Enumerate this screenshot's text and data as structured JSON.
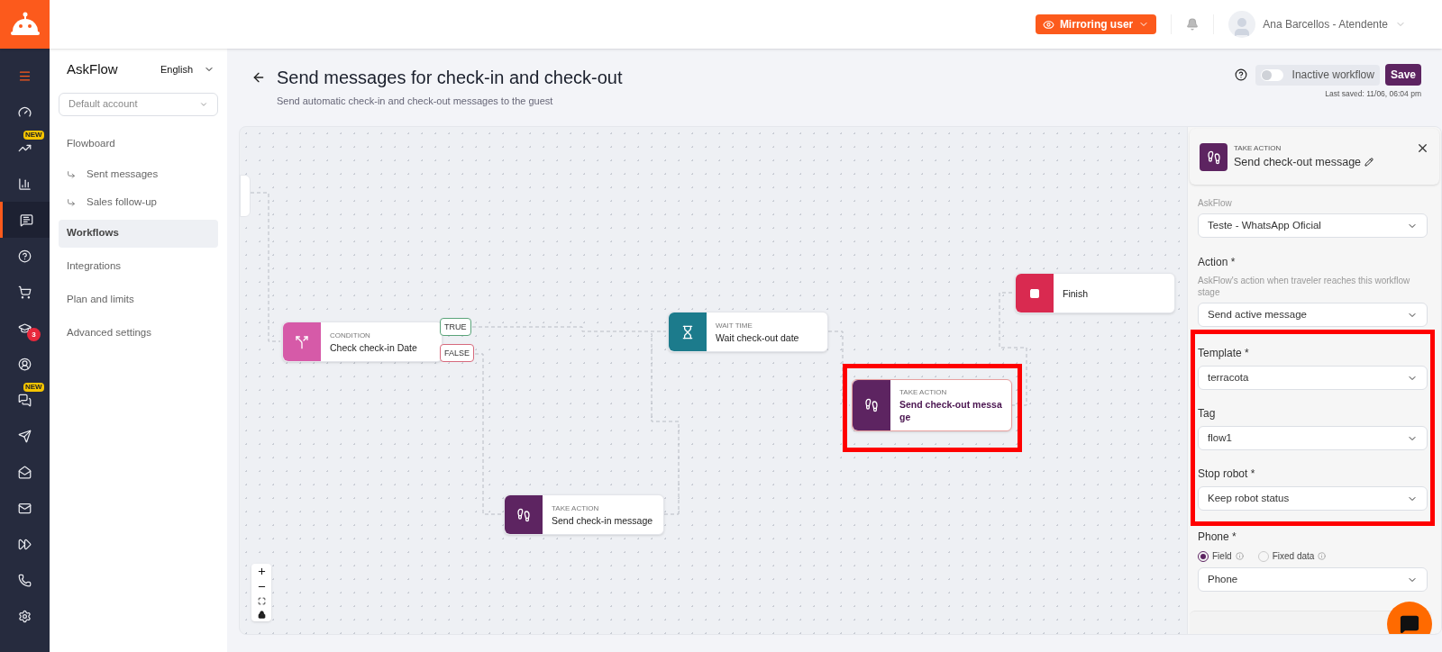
{
  "topbar": {
    "mirroring_button": "Mirroring user",
    "user_name": "Ana Barcellos - Atendente"
  },
  "rail": [
    {
      "selected": false
    },
    {
      "selected": false
    },
    {
      "selected": false,
      "badge": "NEW"
    },
    {
      "selected": false
    },
    {
      "selected": true
    },
    {
      "selected": false
    },
    {
      "selected": false
    },
    {
      "selected": false,
      "badge": "3"
    },
    {
      "selected": false
    },
    {
      "selected": false,
      "badge": "NEW"
    },
    {
      "selected": false
    },
    {
      "selected": false
    },
    {
      "selected": false
    },
    {
      "selected": false
    },
    {
      "selected": false
    },
    {
      "selected": false
    }
  ],
  "sidebar": {
    "brand": "AskFlow",
    "language": "English",
    "account": "Default account",
    "items": [
      {
        "label": "Flowboard",
        "kind": "main",
        "selected": false
      },
      {
        "label": "Sent messages",
        "kind": "sub",
        "selected": false
      },
      {
        "label": "Sales follow-up",
        "kind": "sub",
        "selected": false
      },
      {
        "label": "Workflows",
        "kind": "main",
        "selected": true
      },
      {
        "label": "Integrations",
        "kind": "main",
        "selected": false
      },
      {
        "label": "Plan and limits",
        "kind": "main",
        "selected": false
      },
      {
        "label": "Advanced settings",
        "kind": "main",
        "selected": false
      }
    ]
  },
  "header": {
    "title": "Send messages for check-in and check-out",
    "subtitle": "Send automatic check-in and check-out messages to the guest",
    "toggle": {
      "label": "Inactive workflow",
      "on": false
    },
    "save": "Save",
    "last_saved": "Last saved: 11/06, 06:04 pm"
  },
  "canvas": {
    "nodes": [
      {
        "kind": "condition",
        "caption": "CONDITION",
        "title": "Check check-in Date",
        "highlighted": false,
        "outputs": [
          "TRUE",
          "FALSE"
        ]
      },
      {
        "kind": "wait",
        "caption": "WAIT TIME",
        "title": "Wait check-out date",
        "highlighted": false
      },
      {
        "kind": "action",
        "caption": "TAKE ACTION",
        "title": "Send check-out message",
        "highlighted": true
      },
      {
        "kind": "action",
        "caption": "TAKE ACTION",
        "title": "Send check-in message",
        "highlighted": false
      },
      {
        "kind": "finish",
        "title": "Finish",
        "highlighted": false
      }
    ]
  },
  "panel": {
    "caption": "TAKE ACTION",
    "title": "Send check-out message",
    "cut_text": "AskFlow",
    "sections": [
      {
        "highlighted": false,
        "fields": [
          {
            "value": "Teste - WhatsApp Oficial"
          },
          {
            "label": "Action *",
            "hint": "AskFlow's action when traveler reaches this workflow stage",
            "value": "Send active message"
          }
        ]
      },
      {
        "highlighted": true,
        "fields": [
          {
            "label": "Template *",
            "value": "terracota"
          },
          {
            "label": "Tag",
            "value": "flow1"
          },
          {
            "label": "Stop robot *",
            "value": "Keep robot status"
          }
        ]
      },
      {
        "highlighted": false,
        "fields": [
          {
            "label": "Phone *",
            "value": "Phone",
            "radios": [
              {
                "label": "Field",
                "selected": true
              },
              {
                "label": "Fixed data",
                "selected": false
              }
            ]
          }
        ]
      }
    ]
  }
}
